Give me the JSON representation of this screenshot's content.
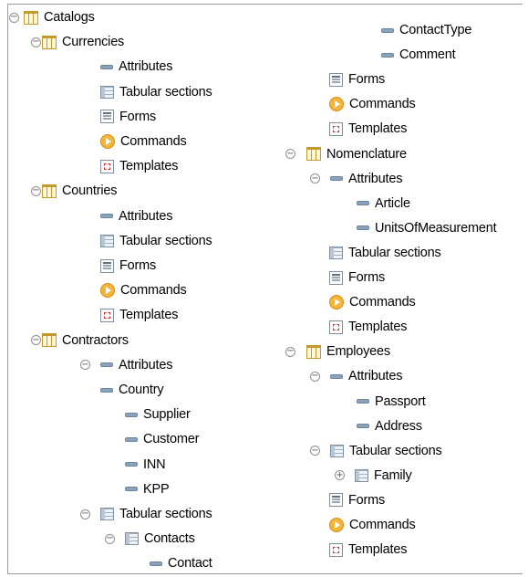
{
  "toggle_symbols": {
    "expanded": "⊖",
    "collapsed": "⊕"
  },
  "tree": {
    "left": [
      {
        "label": "Catalogs",
        "icon": "catalog-icon",
        "toggle": "expanded"
      },
      {
        "label": "Currencies",
        "icon": "catalog-icon",
        "toggle": "expanded"
      },
      {
        "label": "Attributes",
        "icon": "attribute-icon"
      },
      {
        "label": "Tabular sections",
        "icon": "tabular-section-icon"
      },
      {
        "label": "Forms",
        "icon": "form-icon"
      },
      {
        "label": "Commands",
        "icon": "command-icon"
      },
      {
        "label": "Templates",
        "icon": "template-icon"
      },
      {
        "label": "Countries",
        "icon": "catalog-icon",
        "toggle": "expanded"
      },
      {
        "label": "Attributes",
        "icon": "attribute-icon"
      },
      {
        "label": "Tabular sections",
        "icon": "tabular-section-icon"
      },
      {
        "label": "Forms",
        "icon": "form-icon"
      },
      {
        "label": "Commands",
        "icon": "command-icon"
      },
      {
        "label": "Templates",
        "icon": "template-icon"
      },
      {
        "label": "Contractors",
        "icon": "catalog-icon",
        "toggle": "expanded"
      },
      {
        "label": "Attributes",
        "icon": "attribute-icon",
        "toggle": "expanded"
      },
      {
        "label": "Country",
        "icon": "attribute-icon"
      },
      {
        "label": "Supplier",
        "icon": "attribute-icon"
      },
      {
        "label": "Customer",
        "icon": "attribute-icon"
      },
      {
        "label": "INN",
        "icon": "attribute-icon"
      },
      {
        "label": "KPP",
        "icon": "attribute-icon"
      },
      {
        "label": "Tabular sections",
        "icon": "tabular-section-icon",
        "toggle": "expanded"
      },
      {
        "label": "Contacts",
        "icon": "tabular-section-icon",
        "toggle": "expanded"
      },
      {
        "label": "Contact",
        "icon": "attribute-icon"
      }
    ],
    "right": [
      {
        "label": "ContactType",
        "icon": "attribute-icon"
      },
      {
        "label": "Comment",
        "icon": "attribute-icon"
      },
      {
        "label": "Forms",
        "icon": "form-icon"
      },
      {
        "label": "Commands",
        "icon": "command-icon"
      },
      {
        "label": "Templates",
        "icon": "template-icon"
      },
      {
        "label": "Nomenclature",
        "icon": "catalog-icon",
        "toggle": "expanded"
      },
      {
        "label": "Attributes",
        "icon": "attribute-icon",
        "toggle": "expanded"
      },
      {
        "label": "Article",
        "icon": "attribute-icon"
      },
      {
        "label": "UnitsOfMeasurement",
        "icon": "attribute-icon"
      },
      {
        "label": "Tabular sections",
        "icon": "tabular-section-icon"
      },
      {
        "label": "Forms",
        "icon": "form-icon"
      },
      {
        "label": "Commands",
        "icon": "command-icon"
      },
      {
        "label": "Templates",
        "icon": "template-icon"
      },
      {
        "label": "Employees",
        "icon": "catalog-icon",
        "toggle": "expanded"
      },
      {
        "label": "Attributes",
        "icon": "attribute-icon",
        "toggle": "expanded"
      },
      {
        "label": "Passport",
        "icon": "attribute-icon"
      },
      {
        "label": "Address",
        "icon": "attribute-icon"
      },
      {
        "label": "Tabular sections",
        "icon": "tabular-section-icon",
        "toggle": "expanded"
      },
      {
        "label": "Family",
        "icon": "tabular-section-icon",
        "toggle": "collapsed"
      },
      {
        "label": "Forms",
        "icon": "form-icon"
      },
      {
        "label": "Commands",
        "icon": "command-icon"
      },
      {
        "label": "Templates",
        "icon": "template-icon"
      }
    ]
  }
}
